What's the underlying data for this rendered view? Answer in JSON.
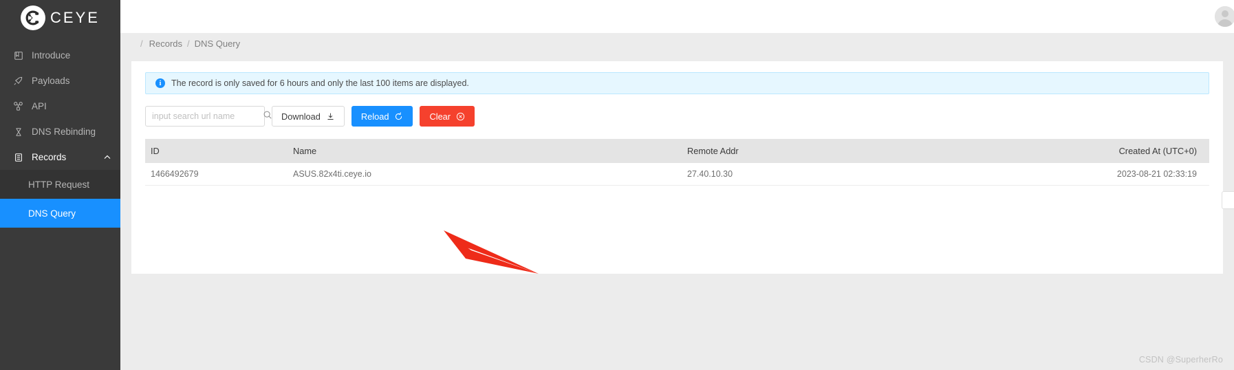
{
  "brand": {
    "name": "CEYE",
    "logo_icon": "ceye-logo-icon"
  },
  "sidebar": {
    "items": [
      {
        "label": "Introduce",
        "icon": "book-icon"
      },
      {
        "label": "Payloads",
        "icon": "rocket-icon"
      },
      {
        "label": "API",
        "icon": "api-icon"
      },
      {
        "label": "DNS Rebinding",
        "icon": "hourglass-icon"
      },
      {
        "label": "Records",
        "icon": "records-icon",
        "expanded": true
      }
    ],
    "sub_items": [
      {
        "label": "HTTP Request",
        "selected": false
      },
      {
        "label": "DNS Query",
        "selected": true
      }
    ]
  },
  "breadcrumb": {
    "leading_sep": "/",
    "items": [
      "Records",
      "DNS Query"
    ],
    "separator": "/"
  },
  "alert": {
    "icon": "info-circle-icon",
    "text": "The record is only saved for 6 hours and only the last 100 items are displayed."
  },
  "toolbar": {
    "search_placeholder": "input search url name",
    "search_value": "",
    "search_icon": "search-icon",
    "download_label": "Download",
    "download_icon": "download-icon",
    "reload_label": "Reload",
    "reload_icon": "refresh-icon",
    "clear_label": "Clear",
    "clear_icon": "close-circle-icon"
  },
  "table": {
    "columns": [
      "ID",
      "Name",
      "Remote Addr",
      "Created At (UTC+0)"
    ],
    "rows": [
      {
        "id": "1466492679",
        "name": "ASUS.82x4ti.ceye.io",
        "remote_addr": "27.40.10.30",
        "created_at": "2023-08-21 02:33:19"
      }
    ]
  },
  "annotation": {
    "arrow_color": "#ee2b19"
  },
  "watermark": {
    "text": "CSDN @SuperherRo"
  },
  "colors": {
    "sidebar_bg": "#3a3a3a",
    "sidebar_sub_bg": "#333333",
    "accent_blue": "#1890ff",
    "danger_red": "#f5412d",
    "page_bg": "#ececec",
    "table_head_bg": "#e4e4e4"
  }
}
